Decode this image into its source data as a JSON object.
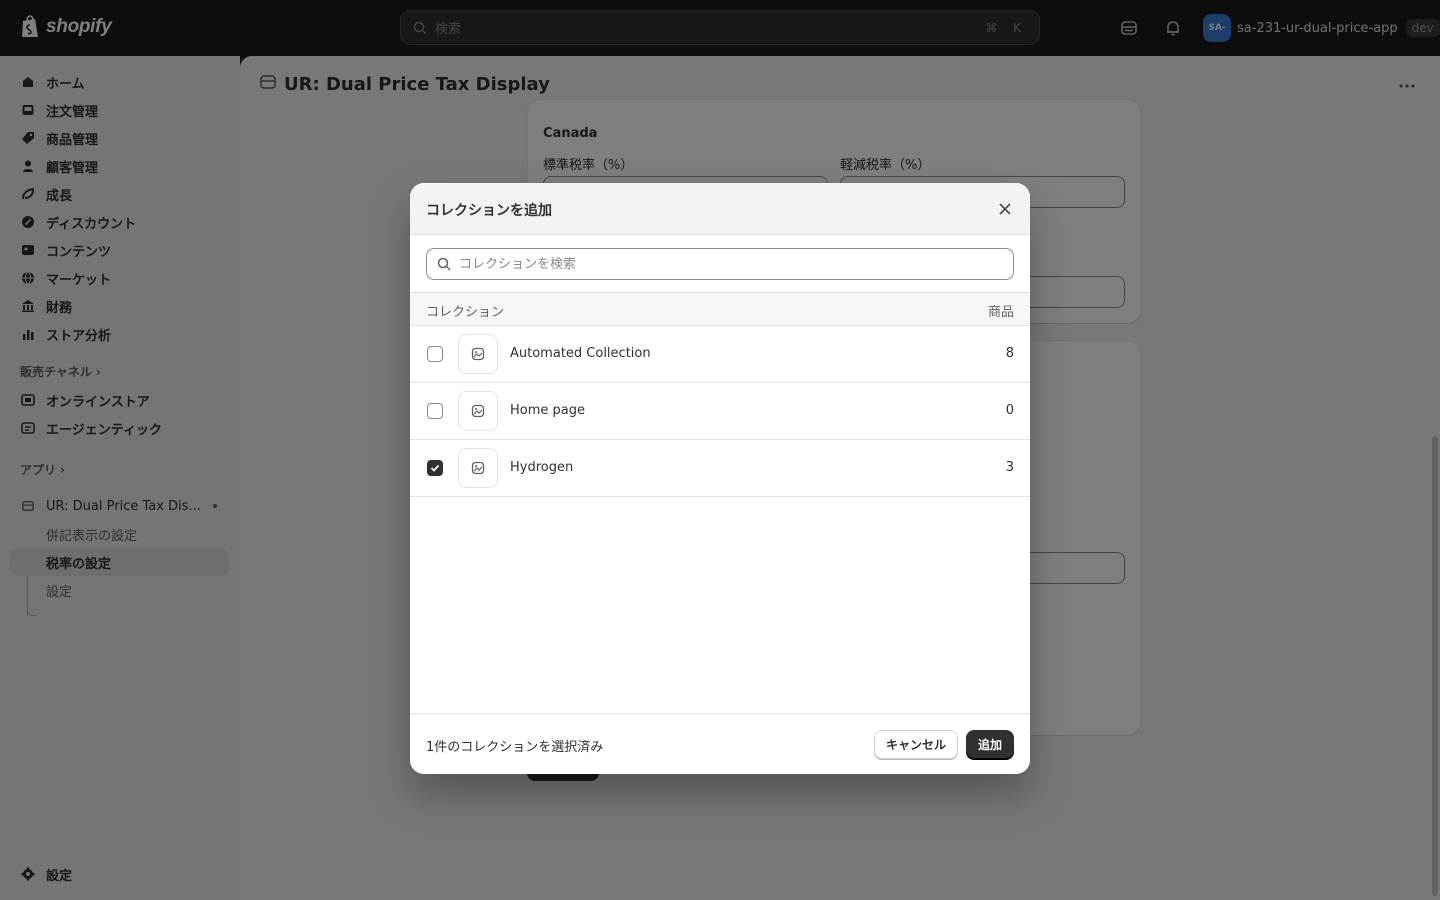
{
  "topbar": {
    "brand": "shopify",
    "search_placeholder": "検索",
    "shortcut": "⌘ K",
    "avatar_text": "SA-",
    "store_name": "sa-231-ur-dual-price-app",
    "env_badge": "dev"
  },
  "sidebar": {
    "items": [
      {
        "label": "ホーム",
        "icon": "home-icon"
      },
      {
        "label": "注文管理",
        "icon": "inbox-icon"
      },
      {
        "label": "商品管理",
        "icon": "tag-icon"
      },
      {
        "label": "顧客管理",
        "icon": "person-icon"
      },
      {
        "label": "成長",
        "icon": "growth-icon"
      },
      {
        "label": "ディスカウント",
        "icon": "discount-icon"
      },
      {
        "label": "コンテンツ",
        "icon": "content-icon"
      },
      {
        "label": "マーケット",
        "icon": "globe-icon"
      },
      {
        "label": "財務",
        "icon": "bank-icon"
      },
      {
        "label": "ストア分析",
        "icon": "chart-icon"
      }
    ],
    "sales_channels_label": "販売チャネル",
    "channels": [
      {
        "label": "オンラインストア",
        "icon": "store-icon"
      },
      {
        "label": "エージェンティック",
        "icon": "agentic-icon"
      }
    ],
    "apps_label": "アプリ",
    "app_name": "UR: Dual Price Tax Dis...",
    "app_subitems": [
      "併記表示の設定",
      "税率の設定",
      "設定"
    ],
    "settings_label": "設定"
  },
  "main": {
    "title": "UR: Dual Price Tax Display",
    "card_title": "Canada",
    "standard_rate_label": "標準税率（%）",
    "reduced_rate_label": "軽減税率（%）"
  },
  "modal": {
    "title": "コレクションを追加",
    "search_placeholder": "コレクションを検索",
    "col_collection": "コレクション",
    "col_products": "商品",
    "rows": [
      {
        "name": "Automated Collection",
        "count": "8",
        "checked": false
      },
      {
        "name": "Home page",
        "count": "0",
        "checked": false
      },
      {
        "name": "Hydrogen",
        "count": "3",
        "checked": true
      }
    ],
    "selected_text": "1件のコレクションを選択済み",
    "cancel_label": "キャンセル",
    "add_label": "追加"
  },
  "colors": {
    "topbar": "#1a1a1a",
    "primary_button": "#303030",
    "avatar": "#3a7bd5"
  }
}
